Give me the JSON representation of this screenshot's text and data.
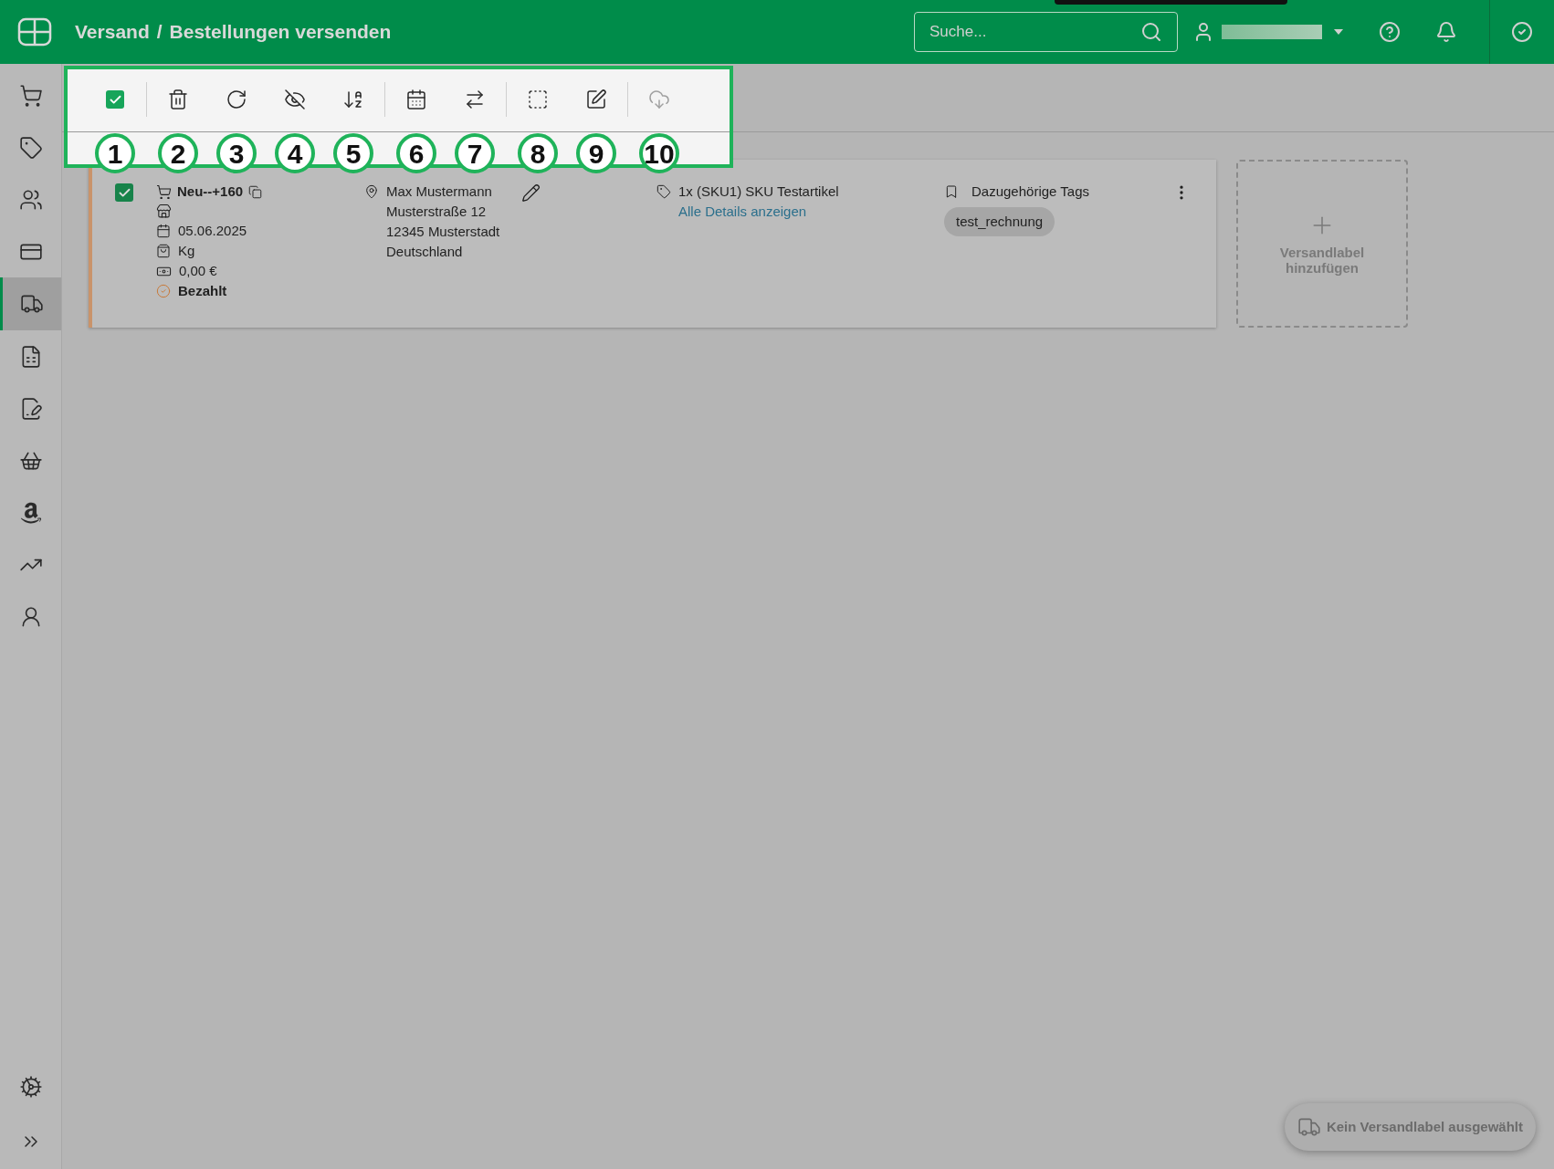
{
  "header": {
    "breadcrumb": [
      "Versand",
      "Bestellungen versenden"
    ],
    "separator": "/",
    "search": {
      "placeholder": "Suche..."
    }
  },
  "sidebar": {
    "items": [
      {
        "selected": false
      },
      {
        "selected": false
      },
      {
        "selected": false
      },
      {
        "selected": false
      },
      {
        "selected": true
      },
      {
        "selected": false
      },
      {
        "selected": false
      },
      {
        "selected": false
      },
      {
        "selected": false
      },
      {
        "selected": false
      },
      {
        "selected": false
      }
    ]
  },
  "toolbar": {
    "items": [
      {
        "kind": "checkbox",
        "checked": true,
        "disabled": false,
        "annotation": "1"
      },
      {
        "kind": "icon",
        "disabled": false,
        "annotation": "2"
      },
      {
        "kind": "icon",
        "disabled": false,
        "annotation": "3"
      },
      {
        "kind": "icon",
        "disabled": false,
        "annotation": "4"
      },
      {
        "kind": "icon",
        "disabled": false,
        "annotation": "5"
      },
      {
        "kind": "icon",
        "disabled": false,
        "annotation": "6"
      },
      {
        "kind": "icon",
        "disabled": false,
        "annotation": "7"
      },
      {
        "kind": "icon",
        "disabled": false,
        "annotation": "8"
      },
      {
        "kind": "icon",
        "disabled": false,
        "annotation": "9"
      },
      {
        "kind": "icon",
        "disabled": true,
        "annotation": "10"
      }
    ]
  },
  "order": {
    "checked": true,
    "number": "Neu--+160",
    "date": "05.06.2025",
    "weight": "Kg",
    "amount": "0,00 €",
    "status": "Bezahlt",
    "address": [
      "Max Mustermann",
      "Musterstraße 12",
      "12345 Musterstadt",
      "Deutschland"
    ],
    "item": "1x (SKU1) SKU Testartikel",
    "details_link": "Alle Details anzeigen",
    "tags_heading": "Dazugehörige Tags",
    "tags": [
      "test_rechnung"
    ]
  },
  "add_label": "Versandlabel hinzufügen",
  "shipping_button": "Kein Versandlabel ausgewählt"
}
